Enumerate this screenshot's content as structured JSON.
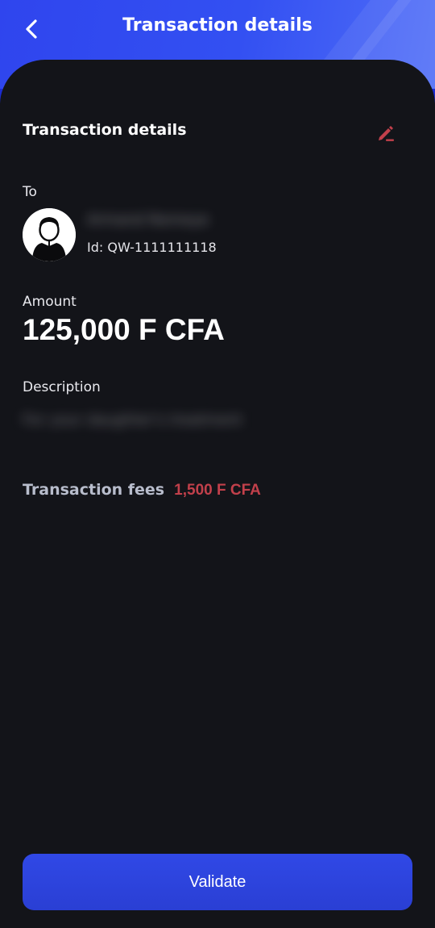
{
  "header": {
    "title": "Transaction details",
    "back_icon": "chevron-left-icon"
  },
  "details": {
    "section_title": "Transaction details",
    "edit_icon": "pencil-icon",
    "to_label": "To",
    "recipient": {
      "name": "Armand Nomeye",
      "id_text": "Id: QW-1111111118",
      "avatar_icon": "user-avatar-icon"
    },
    "amount_label": "Amount",
    "amount_value": "125,000 F CFA",
    "description_label": "Description",
    "description_value": "For your daughter's treatment",
    "fees_label": "Transaction fees",
    "fees_value": "1,500 F CFA"
  },
  "actions": {
    "validate_label": "Validate"
  },
  "colors": {
    "header_blue": "#3350f2",
    "background": "#131419",
    "fees_accent": "#c2404b",
    "button_blue": "#2d44de"
  }
}
